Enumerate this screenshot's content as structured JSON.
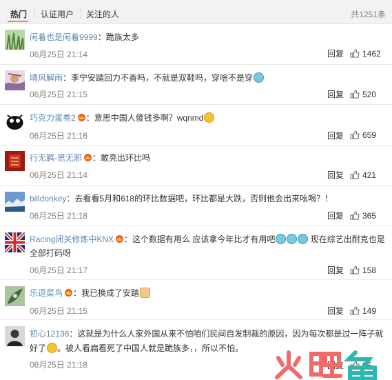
{
  "tabs": [
    {
      "label": "热门",
      "active": true
    },
    {
      "label": "认证用户",
      "active": false
    },
    {
      "label": "关注的人",
      "active": false
    }
  ],
  "total_count": "共1251条",
  "reply_label": "回复",
  "accent_color": "#fa7d3c",
  "username_color": "#5b87b5",
  "comments": [
    {
      "user": "闲着也是闲着9999",
      "text": "跪族太多",
      "time": "06月25日 21:14",
      "likes": "1462"
    },
    {
      "user": "晴风解雨",
      "text": "李宁安踏回力不香吗，不就是双鞋吗，穿啥不是穿",
      "time": "06月25日 21:15",
      "likes": "520"
    },
    {
      "user": "巧克力蛋卷2",
      "text": "意思中国人傻钱多啊？wqnmd",
      "time": "06月25日 21:16",
      "likes": "659"
    },
    {
      "user": "行无羁-思无邪",
      "text": "敢亮出环比吗",
      "time": "06月25日 21:14",
      "likes": "421"
    },
    {
      "user": "billdonkey",
      "text": "去看看5月和618的环比数据吧，环比都是大跌，否则他会出来吆喝？！",
      "time": "06月25日 21:18",
      "likes": "365"
    },
    {
      "user": "Racing闭关修炼中KNX",
      "text": "这个数据有用么 应该拿今年比才有用吧",
      "text2": "现在综艺出耐克也是全部打码呀",
      "time": "06月25日 21:17",
      "likes": "158"
    },
    {
      "user": "乐逗菜鸟",
      "text": "我已换成了安踏",
      "time": "06月25日 21:15",
      "likes": "149"
    },
    {
      "user": "初心12136",
      "text": "这就是为什么人家外国从来不怕咱们民间自发制裁的原因，因为每次都是过一阵子就好了",
      "text2": "。被人看扁看死了中国人就是跪族多，，所以不怕。",
      "time": "06月25日 21:18",
      "likes": "95"
    }
  ],
  "watermark": "火鲤鱼"
}
